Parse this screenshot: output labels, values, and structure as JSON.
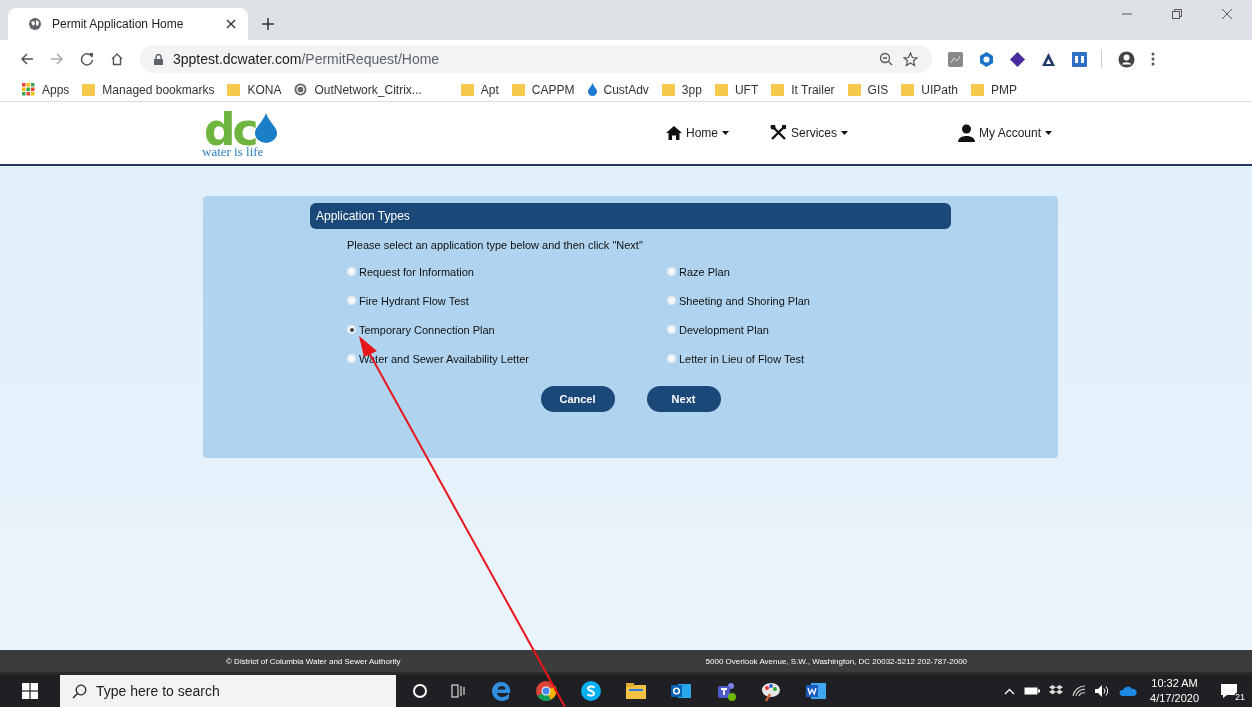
{
  "browser": {
    "tab_title": "Permit Application Home",
    "url_host": "3pptest.dcwater.com",
    "url_path": "/PermitRequest/Home",
    "bookmarks": [
      {
        "label": "Apps",
        "kind": "apps"
      },
      {
        "label": "Managed bookmarks",
        "kind": "folder"
      },
      {
        "label": "KONA",
        "kind": "folder"
      },
      {
        "label": "OutNetwork_Citrix...",
        "kind": "site"
      },
      {
        "label": "Apt",
        "kind": "folder"
      },
      {
        "label": "CAPPM",
        "kind": "folder"
      },
      {
        "label": "CustAdv",
        "kind": "drop"
      },
      {
        "label": "3pp",
        "kind": "folder"
      },
      {
        "label": "UFT",
        "kind": "folder"
      },
      {
        "label": "It Trailer",
        "kind": "folder"
      },
      {
        "label": "GIS",
        "kind": "folder"
      },
      {
        "label": "UIPath",
        "kind": "folder"
      },
      {
        "label": "PMP",
        "kind": "folder"
      }
    ]
  },
  "site": {
    "logo_text": "dc",
    "tagline": "water is life",
    "nav": [
      {
        "label": "Home",
        "kind": "home"
      },
      {
        "label": "Services",
        "kind": "services"
      },
      {
        "label": "My Account",
        "kind": "account"
      }
    ]
  },
  "form": {
    "title": "Application Types",
    "instructions": "Please select an application type below and then click \"Next\"",
    "options": [
      {
        "label": "Request for Information",
        "selected": false
      },
      {
        "label": "Raze Plan",
        "selected": false
      },
      {
        "label": "Fire Hydrant Flow Test",
        "selected": false
      },
      {
        "label": "Sheeting and Shoring Plan",
        "selected": false
      },
      {
        "label": "Temporary Connection Plan",
        "selected": true
      },
      {
        "label": "Development Plan",
        "selected": false
      },
      {
        "label": "Water and Sewer Availability Letter",
        "selected": false
      },
      {
        "label": "Letter in Lieu of Flow Test",
        "selected": false
      }
    ],
    "buttons": [
      {
        "label": "Cancel"
      },
      {
        "label": "Next"
      }
    ]
  },
  "footer": {
    "left": "© District of Columbia Water and Sewer Authority",
    "right": "5000 Overlook Avenue, S.W., Washington, DC 20032-5212 202-787-2000"
  },
  "taskbar": {
    "search_placeholder": "Type here to search",
    "time": "10:32 AM",
    "date": "4/17/2020",
    "notification_count": "21"
  }
}
